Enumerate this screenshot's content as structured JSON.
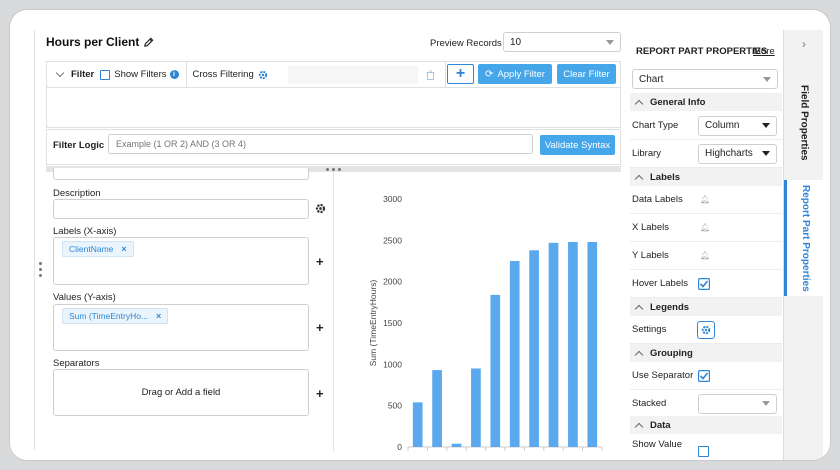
{
  "header": {
    "title": "Hours per Client",
    "preview_label": "Preview Records",
    "preview_value": "10"
  },
  "filter": {
    "label": "Filter",
    "show_filters": "Show Filters",
    "cross_filtering": "Cross Filtering",
    "apply": "Apply Filter",
    "clear": "Clear Filter",
    "logic_label": "Filter Logic",
    "logic_placeholder": "Example (1 OR 2) AND (3 OR 4)",
    "validate": "Validate Syntax"
  },
  "fields": {
    "description_label": "Description",
    "labels_label": "Labels (X-axis)",
    "labels_chip": "ClientName",
    "values_label": "Values (Y-axis)",
    "values_chip": "Sum (TimeEntryHo...",
    "separators_label": "Separators",
    "separators_placeholder": "Drag or Add a field"
  },
  "chart_data": {
    "type": "bar",
    "ylabel": "Sum (TimeEntryHours)",
    "xlabel": "",
    "title": "",
    "ylim": [
      0,
      3000
    ],
    "yticks": [
      "3000",
      "2500",
      "2000",
      "1500",
      "1000",
      "500",
      "0"
    ],
    "values": [
      540,
      930,
      40,
      950,
      1840,
      2250,
      2380,
      2470,
      2480,
      2480
    ],
    "color": "#5aa9ee",
    "grid": false
  },
  "properties": {
    "heading": "REPORT PART PROPERTIES",
    "more": "More",
    "part_type": "Chart",
    "general_info": "General Info",
    "chart_type_label": "Chart Type",
    "chart_type_value": "Column",
    "library_label": "Library",
    "library_value": "Highcharts",
    "labels_header": "Labels",
    "data_labels": "Data Labels",
    "x_labels": "X Labels",
    "y_labels": "Y Labels",
    "hover_labels": "Hover Labels",
    "legends_header": "Legends",
    "settings": "Settings",
    "grouping_header": "Grouping",
    "use_separator": "Use Separator",
    "stacked": "Stacked",
    "data_header": "Data",
    "show_value": "Show Value"
  },
  "tabs": {
    "field_properties": "Field Properties",
    "report_part_properties": "Report Part Properties"
  },
  "colors": {
    "accent": "#2f86d6",
    "button": "#45a6ea"
  }
}
